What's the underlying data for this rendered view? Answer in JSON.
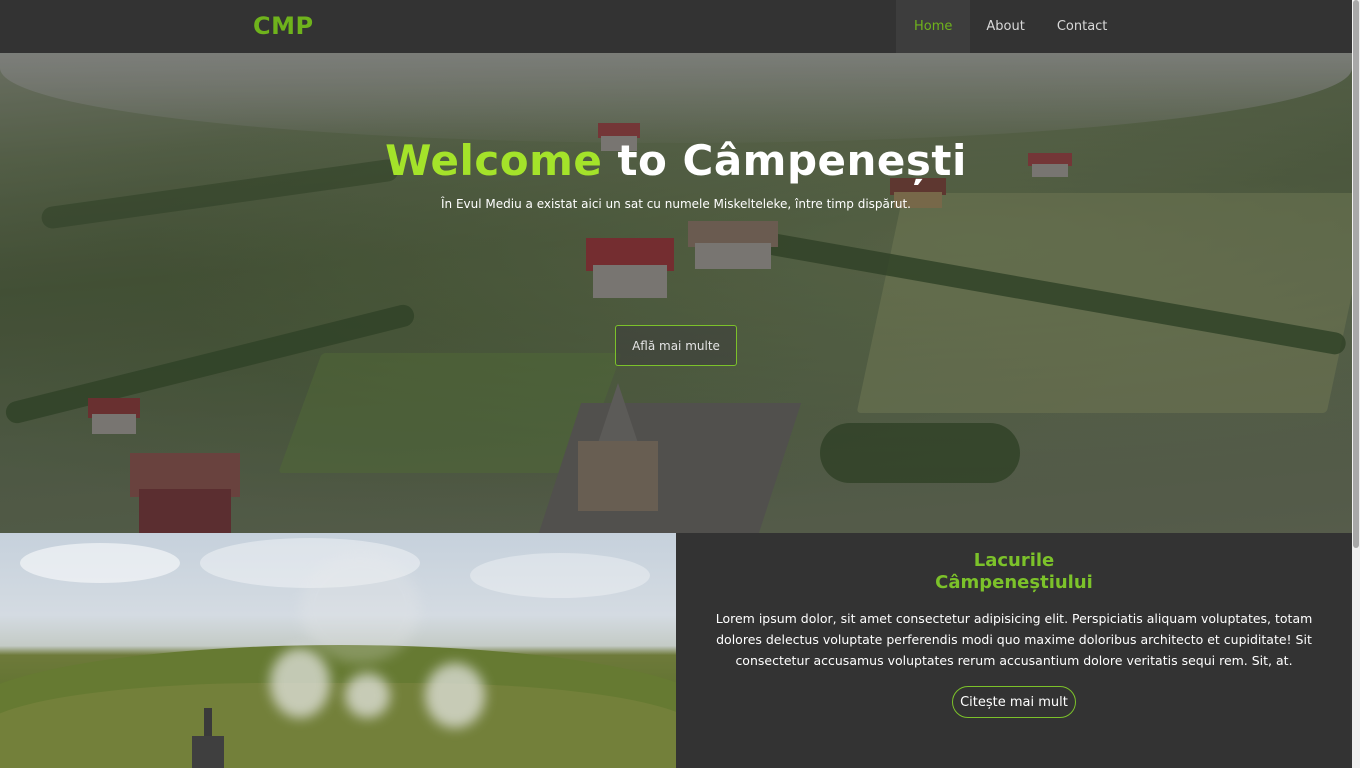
{
  "nav": {
    "brand": "CMP",
    "links": [
      {
        "label": "Home",
        "active": true
      },
      {
        "label": "About",
        "active": false
      },
      {
        "label": "Contact",
        "active": false
      }
    ]
  },
  "hero": {
    "title_accent": "Welcome",
    "title_rest": " to Câmpenești",
    "subtitle": "În Evul Mediu a existat aici un sat cu numele Miskelteleke, între timp dispărut.",
    "button": "Află mai multe"
  },
  "section": {
    "title_line1": "Lacurile",
    "title_line2": "Câmpeneștiului",
    "text": "Lorem ipsum dolor, sit amet consectetur adipisicing elit. Perspiciatis aliquam voluptates, totam dolores delectus voluptate perferendis modi quo maxime doloribus architecto et cupiditate! Sit consectetur accusamus voluptates rerum accusantium dolore veritatis sequi rem. Sit, at.",
    "button": "Citește mai mult"
  },
  "colors": {
    "accent": "#7cc22a",
    "title_accent": "#a4e32a",
    "navbar": "#333333"
  }
}
